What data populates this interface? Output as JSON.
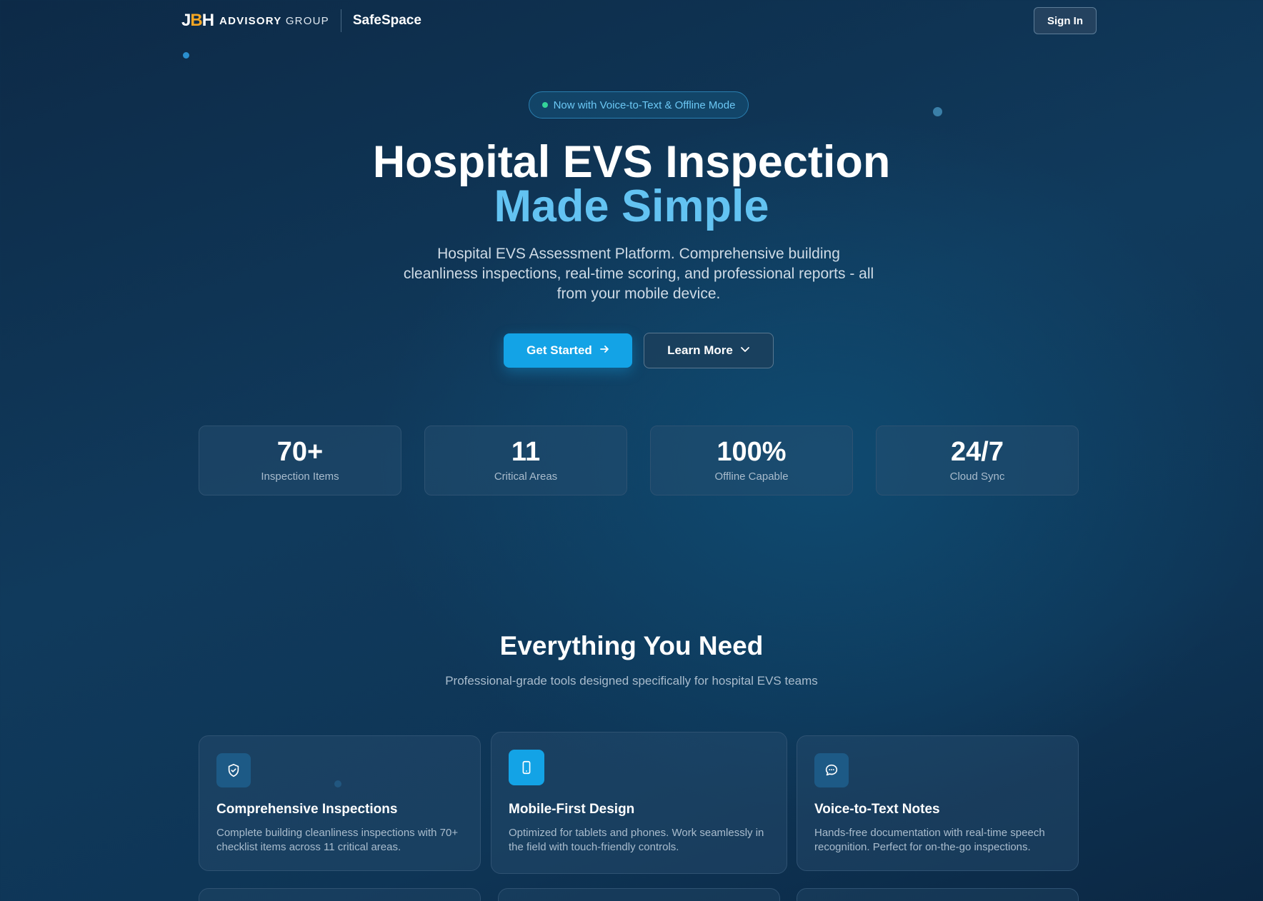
{
  "header": {
    "logo_mark_j": "J",
    "logo_mark_b": "B",
    "logo_mark_h": "H",
    "logo_advisory": "ADVISORY",
    "logo_group": "GROUP",
    "app_name": "SafeSpace",
    "signin_label": "Sign In"
  },
  "hero": {
    "badge": "Now with Voice-to-Text & Offline Mode",
    "title_line1": "Hospital EVS Inspection",
    "title_line2": "Made Simple",
    "lead": "Hospital EVS Assessment Platform. Comprehensive building cleanliness inspections, real-time scoring, and professional reports - all from your mobile device.",
    "primary_button": "Get Started",
    "secondary_button": "Learn More"
  },
  "stats": [
    {
      "value": "70+",
      "label": "Inspection Items"
    },
    {
      "value": "11",
      "label": "Critical Areas"
    },
    {
      "value": "100%",
      "label": "Offline Capable"
    },
    {
      "value": "24/7",
      "label": "Cloud Sync"
    }
  ],
  "features": {
    "title": "Everything You Need",
    "subtitle": "Professional-grade tools designed specifically for hospital EVS teams",
    "cards": [
      {
        "icon": "shield-check-icon",
        "title": "Comprehensive Inspections",
        "desc": "Complete building cleanliness inspections with 70+ checklist items across 11 critical areas."
      },
      {
        "icon": "mobile-device-icon",
        "title": "Mobile-First Design",
        "desc": "Optimized for tablets and phones. Work seamlessly in the field with touch-friendly controls."
      },
      {
        "icon": "chat-bubble-icon",
        "title": "Voice-to-Text Notes",
        "desc": "Hands-free documentation with real-time speech recognition. Perfect for on-the-go inspections."
      }
    ]
  },
  "colors": {
    "accent": "#13a3e6",
    "highlight": "#63c3f2",
    "logo_orange": "#f5a623",
    "badge_dot": "#34d399"
  }
}
